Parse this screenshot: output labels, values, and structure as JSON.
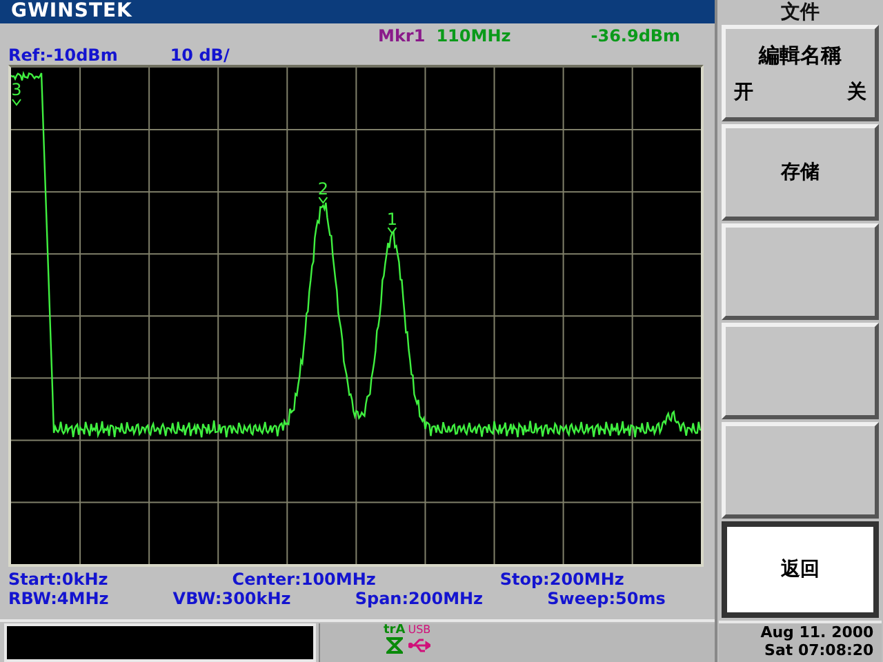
{
  "header": {
    "logo": "GWINSTEK"
  },
  "marker_readout": {
    "label": "Mkr1",
    "frequency": "110MHz",
    "amplitude": "-36.9dBm"
  },
  "scale": {
    "reference": "Ref:-10dBm",
    "per_division": "10 dB/"
  },
  "trace_markers": [
    {
      "label": "3"
    },
    {
      "label": "2"
    },
    {
      "label": "1"
    }
  ],
  "settings": [
    [
      "Start:0kHz",
      "Center:100MHz",
      "Stop:200MHz"
    ],
    [
      "RBW:4MHz",
      "VBW:300kHz",
      "Span:200MHz",
      "Sweep:50ms"
    ]
  ],
  "menu": {
    "title": "文件",
    "softkeys": [
      {
        "kind": "toggle",
        "label": "編輯名稱",
        "options": [
          "开",
          "关"
        ],
        "selected": false
      },
      {
        "kind": "plain",
        "label": "存储",
        "selected": false
      },
      {
        "kind": "blank",
        "selected": false
      },
      {
        "kind": "blank",
        "selected": false
      },
      {
        "kind": "blank",
        "selected": false
      },
      {
        "kind": "plain",
        "label": "返回",
        "selected": true
      }
    ]
  },
  "status_bar": {
    "indicators": [
      {
        "kind": "trigger",
        "label": "trA"
      },
      {
        "kind": "usb",
        "label": "USB"
      }
    ],
    "date": "Aug 11. 2000",
    "time": "Sat 07:08:20"
  }
}
